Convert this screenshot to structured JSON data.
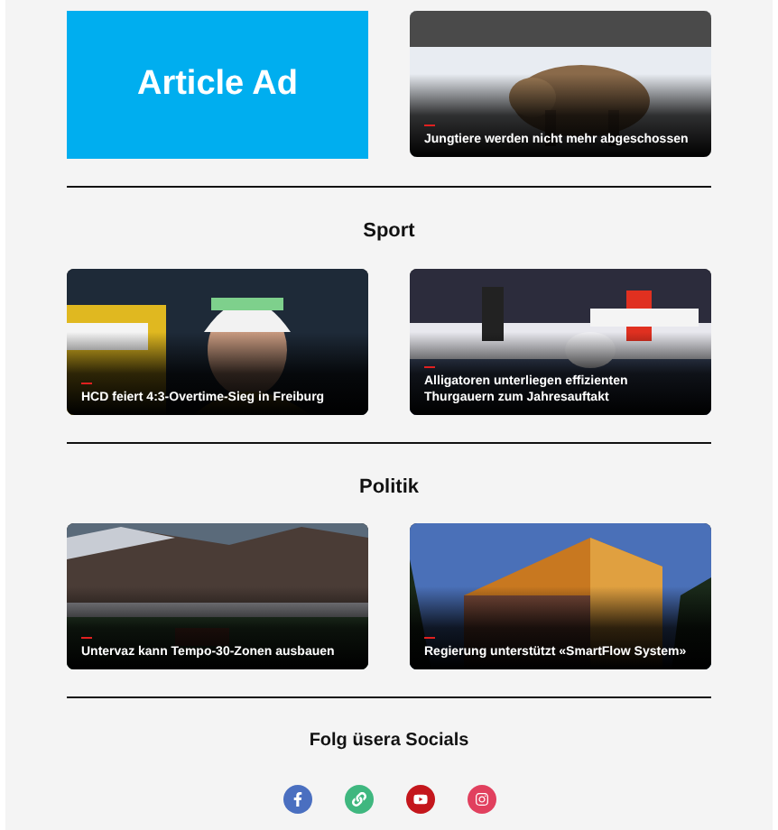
{
  "top": {
    "ad": {
      "label": "Article Ad"
    },
    "article": {
      "title": "Jungtiere werden nicht mehr abgeschossen"
    }
  },
  "sections": [
    {
      "heading": "Sport",
      "articles": [
        {
          "title": "HCD feiert 4:3-Overtime-Sieg in Freiburg"
        },
        {
          "title": "Alligatoren unterliegen effizienten Thurgauern zum Jahresauftakt"
        }
      ]
    },
    {
      "heading": "Politik",
      "articles": [
        {
          "title": "Untervaz kann Tempo-30-Zonen ausbauen"
        },
        {
          "title": "Regierung unterstützt «SmartFlow System»"
        }
      ]
    }
  ],
  "socials": {
    "heading": "Folg üsera Socials",
    "links": [
      {
        "kind": "facebook",
        "color": "#4a6fc0"
      },
      {
        "kind": "link",
        "color": "#3fb77f"
      },
      {
        "kind": "youtube",
        "color": "#c4161c"
      },
      {
        "kind": "instagram",
        "color": "#e1405e"
      }
    ]
  }
}
